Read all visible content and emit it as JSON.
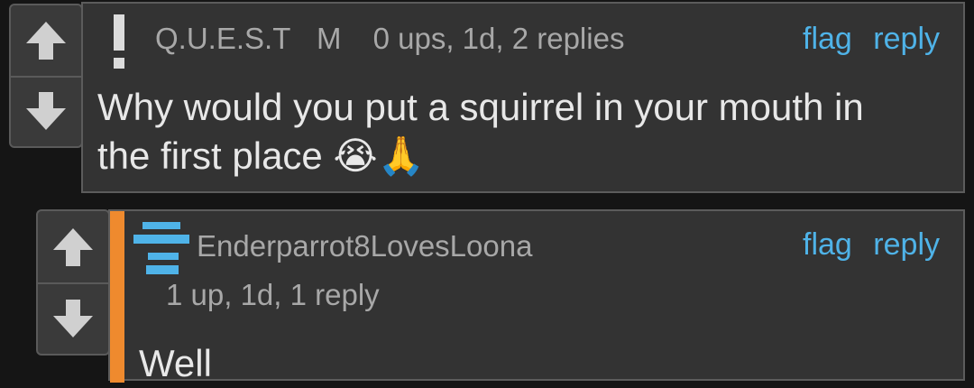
{
  "comment1": {
    "flair_symbol": "!",
    "username": "Q.U.E.S.T",
    "badge": "M",
    "stats": "0 ups, 1d, 2 replies",
    "flag_label": "flag",
    "reply_label": "reply",
    "text_line1": "Why would you put a squirrel in your mouth in",
    "text_line2": "the first place 😭🙏"
  },
  "comment2": {
    "username": "Enderparrot8LovesLoona",
    "stats": "1 up, 1d, 1 reply",
    "flag_label": "flag",
    "reply_label": "reply",
    "text": "Well"
  },
  "colors": {
    "accent_link": "#4fb3e8",
    "thread_bar": "#ef8a2e",
    "avatar_blue": "#4fb3e8"
  },
  "icons": [
    "arrow-up-icon",
    "arrow-down-icon",
    "exclamation-icon",
    "user-avatar-icon"
  ]
}
